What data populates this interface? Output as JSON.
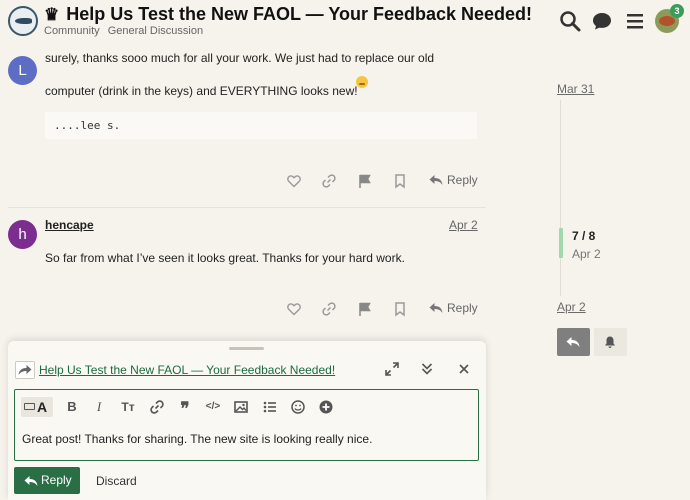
{
  "header": {
    "title": "Help Us Test the New FAOL — Your Feedback Needed!",
    "title_icon": "crown-icon",
    "breadcrumb": [
      "Community",
      "General Discussion"
    ],
    "notification_count": "3"
  },
  "posts": [
    {
      "avatar_letter": "L",
      "avatar_color": "#5b6ec4",
      "text_lines": [
        "surely, thanks sooo much for all your work. We just had to replace our old",
        "computer (drink in the keys) and EVERYTHING looks new!"
      ],
      "code": "....lee s.",
      "reply_label": "Reply"
    },
    {
      "avatar_letter": "h",
      "avatar_color": "#7b2e8f",
      "username": "hencape",
      "date": "Apr 2",
      "text": "So far from what I’ve seen it looks great. Thanks for your hard work.",
      "reply_label": "Reply"
    }
  ],
  "timeline": {
    "start_date": "Mar 31",
    "position": "7 / 8",
    "position_date": "Apr 2",
    "end_date": "Apr 2"
  },
  "composer": {
    "reply_to_title": "Help Us Test the New FAOL — Your Feedback Needed!",
    "editor_text": "Great post! Thanks for sharing. The new site is looking really nice.",
    "reply_button": "Reply",
    "discard_button": "Discard"
  },
  "colors": {
    "accent": "#2a6e45",
    "background": "#f6f3ec",
    "timeline_handle": "#a3d7ad",
    "notification": "#3c9d5a"
  }
}
